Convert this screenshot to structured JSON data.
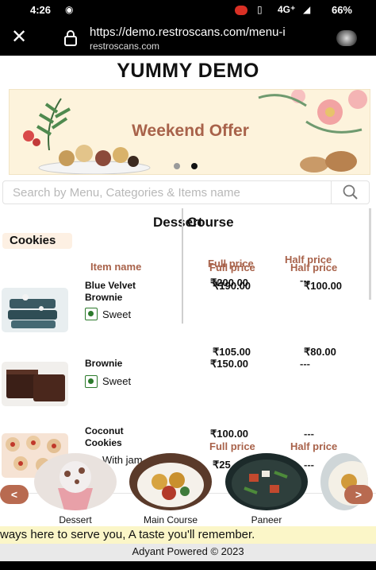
{
  "status_bar": {
    "time": "4:26",
    "network": "4G⁺",
    "battery": "66%"
  },
  "browser": {
    "url": "https://demo.restroscans.com/menu-i",
    "domain": "restroscans.com"
  },
  "header": {
    "brand": "YUMMY DEMO"
  },
  "banner": {
    "title": "Weekend Offer",
    "accent": "#a8624a",
    "slide_count": 2,
    "active_slide": 2
  },
  "search": {
    "placeholder": "Search by Menu, Categories & Items name"
  },
  "menu": {
    "section_title_back": "Dessert",
    "section_title_front": "Course",
    "category": "Cookies",
    "headers": {
      "item_name": "Item name",
      "full_price": "Full price",
      "half_price": "Half price",
      "full_price_b": "Full price",
      "half_price_b": "Half price"
    },
    "items": [
      {
        "name": "Blue Velvet Brownie",
        "tag": "Sweet",
        "full": "₹200.00",
        "full_overlap": "₹190.00",
        "half": "₹100.00",
        "half_overlap": "---"
      },
      {
        "name": "Brownie",
        "tag": "Sweet",
        "full_top": "₹105.00",
        "full": "₹150.00",
        "half_top": "₹80.00",
        "half": "---"
      },
      {
        "name": "Coconut Cookies",
        "tag": "With jam",
        "full": "₹100.00",
        "full_partial": "₹25",
        "half": "---",
        "half_b": "---"
      }
    ],
    "header_colors": {
      "label": "#a8624a"
    }
  },
  "categories": [
    {
      "label": "Dessert"
    },
    {
      "label": "Main Course"
    },
    {
      "label": "Paneer"
    }
  ],
  "carousel": {
    "prev": "<",
    "next": ">"
  },
  "ticker": {
    "text": "ways here to serve you, A taste you'll remember."
  },
  "footer": {
    "text": "Adyant Powered © 2023"
  },
  "icons": [
    "close-icon",
    "lock-icon",
    "menu-icon",
    "search-icon",
    "veg-icon"
  ]
}
